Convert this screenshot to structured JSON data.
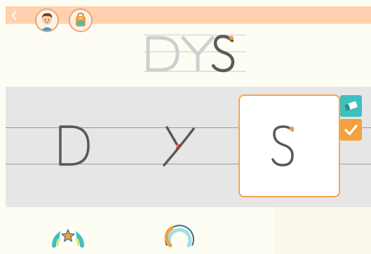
{
  "app": {
    "icons": {
      "back": "chevron-left-icon",
      "boy_avatar": "boy-avatar-icon",
      "backpack": "backpack-icon",
      "eraser": "eraser-icon",
      "check": "checkmark-icon",
      "star_medal": "star-badge-icon",
      "progress_ring": "progress-ring-icon"
    },
    "colors": {
      "topbar": "#ffd1b0",
      "accent_orange": "#f2a040",
      "eraser_teal": "#3fbfbe",
      "stroke_gray": "#555555",
      "tracing_gray": "#c9c9c9",
      "board": "#e6e6e6"
    }
  },
  "word": {
    "letters": [
      "D",
      "Y",
      "S"
    ],
    "traced_letters": [
      "D",
      "Y"
    ],
    "current_letter": "S"
  },
  "board": {
    "cells": [
      {
        "letter": "D",
        "state": "done"
      },
      {
        "letter": "Y",
        "state": "done"
      },
      {
        "letter": "S",
        "state": "active"
      }
    ]
  },
  "progress": {
    "ring_fraction": 0.3
  }
}
